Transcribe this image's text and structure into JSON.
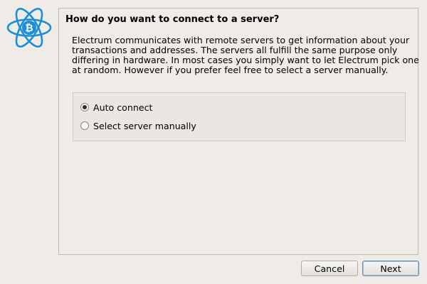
{
  "wizard": {
    "heading": "How do you want to connect to a server?",
    "description_lines": [
      "Electrum communicates with remote servers to get information about your",
      "transactions and addresses. The servers all fulfill the same purpose only",
      "differing in hardware. In most cases you simply want to let Electrum pick one",
      "at random.  However if you prefer feel free to select a server manually."
    ],
    "options": [
      {
        "label": "Auto connect",
        "selected": true
      },
      {
        "label": "Select server manually",
        "selected": false
      }
    ]
  },
  "buttons": {
    "cancel_label": "Cancel",
    "next_label": "Next"
  },
  "logo": {
    "icon": "electrum-bitcoin-atom-icon",
    "color": "#1d8ed4"
  }
}
